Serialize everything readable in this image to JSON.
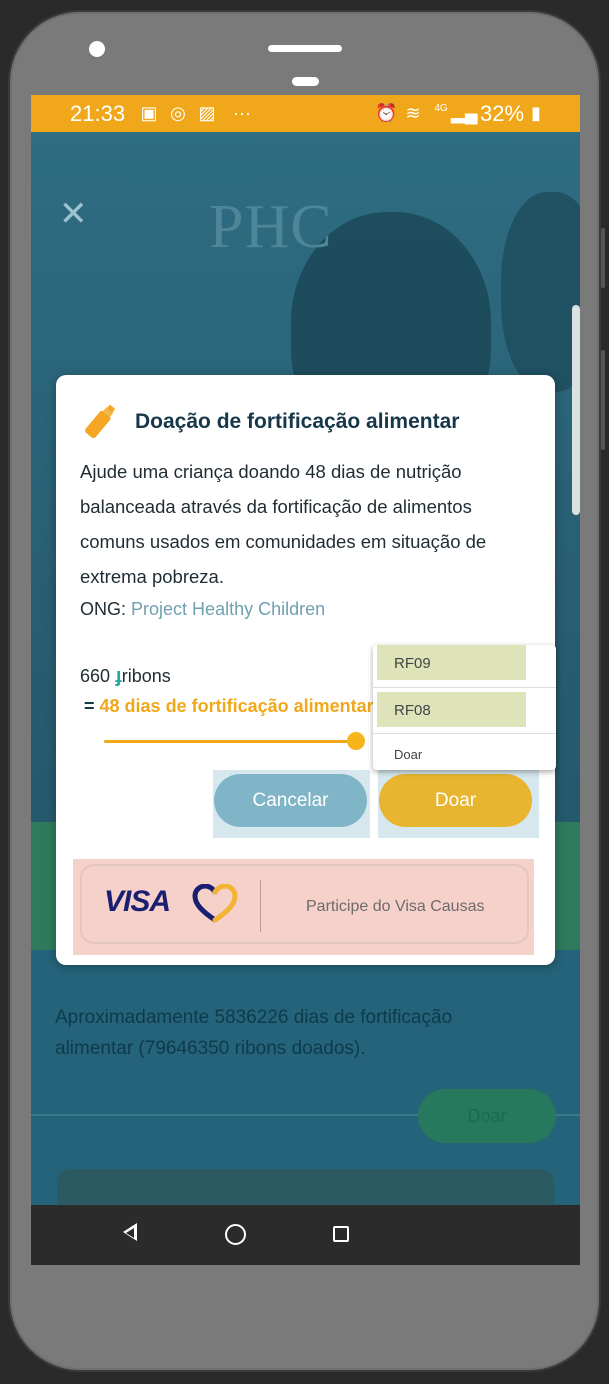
{
  "status_bar": {
    "time": "21:33",
    "notification_icons": [
      "gallery-icon",
      "whatsapp-icon",
      "image-icon",
      "more-dots-icon"
    ],
    "system_icons": [
      "alarm-icon",
      "wifi-icon",
      "signal-4g-icon",
      "battery-icon"
    ],
    "network_label": "4G",
    "battery": "32%"
  },
  "background": {
    "logo": "PHC",
    "stats_text": "Aproximadamente 5836226 dias de fortificação alimentar (79646350 ribons doados).",
    "donate_label": "Doar"
  },
  "dialog": {
    "title": "Doação de fortificação alimentar",
    "body": "Ajude uma criança doando 48 dias de nutrição balanceada através da fortificação de alimentos comuns usados em comunidades em situação de extrema pobreza.",
    "ong_label": "ONG:",
    "ong_name": "Project Healthy Children",
    "ribons_amount": "660",
    "ribons_unit": "ribons",
    "equals": "=",
    "equivalent": "48 dias de fortificação alimentar",
    "slider_fraction": 1.0,
    "cancel_label": "Cancelar",
    "donate_label": "Doar",
    "visa_brand": "VISA",
    "visa_cta": "Participe do Visa Causas"
  },
  "dropdown": {
    "items": [
      "RF09",
      "RF08",
      "Doar"
    ]
  },
  "colors": {
    "status_bar": "#f0a81a",
    "accent_orange": "#f0a81a",
    "cancel_button": "#7fb5c7",
    "donate_button": "#e7b530",
    "title": "#17384a",
    "link": "#6f9fb0"
  }
}
